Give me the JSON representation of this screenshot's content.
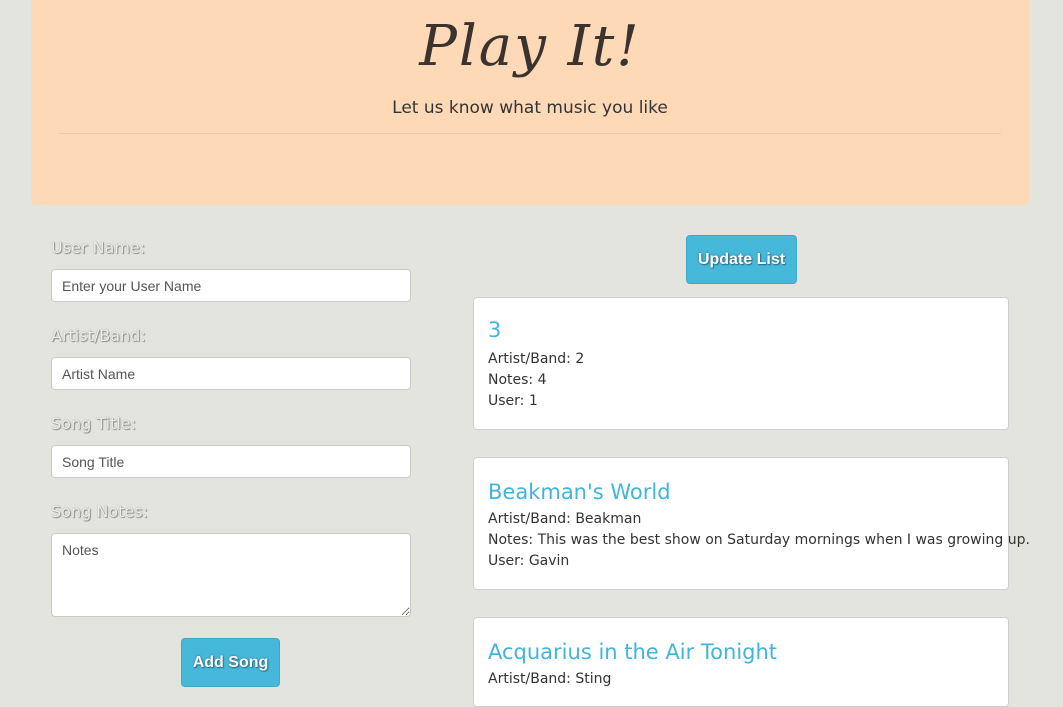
{
  "header": {
    "title": "Play It!",
    "subtitle": "Let us know what music you like"
  },
  "form": {
    "user_label": "User Name:",
    "user_placeholder": "Enter your User Name",
    "artist_label": "Artist/Band:",
    "artist_placeholder": "Artist Name",
    "song_label": "Song Title:",
    "song_placeholder": "Song Title",
    "notes_label": "Song Notes:",
    "notes_placeholder": "Notes",
    "add_button": "Add Song"
  },
  "list": {
    "update_button": "Update List",
    "songs": [
      {
        "title": "3",
        "artist": "Artist/Band: 2",
        "notes": "Notes: 4",
        "user": "User: 1"
      },
      {
        "title": "Beakman's World",
        "artist": "Artist/Band: Beakman",
        "notes": "Notes: This was the best show on Saturday mornings when I was growing up.",
        "user": "User: Gavin"
      },
      {
        "title": "Acquarius in the Air Tonight",
        "artist": "Artist/Band: Sting"
      }
    ]
  },
  "colors": {
    "header_bg": "#fed9b7",
    "page_bg": "#e4e4df",
    "accent": "#46b8da",
    "title_link": "#40b5dc"
  }
}
